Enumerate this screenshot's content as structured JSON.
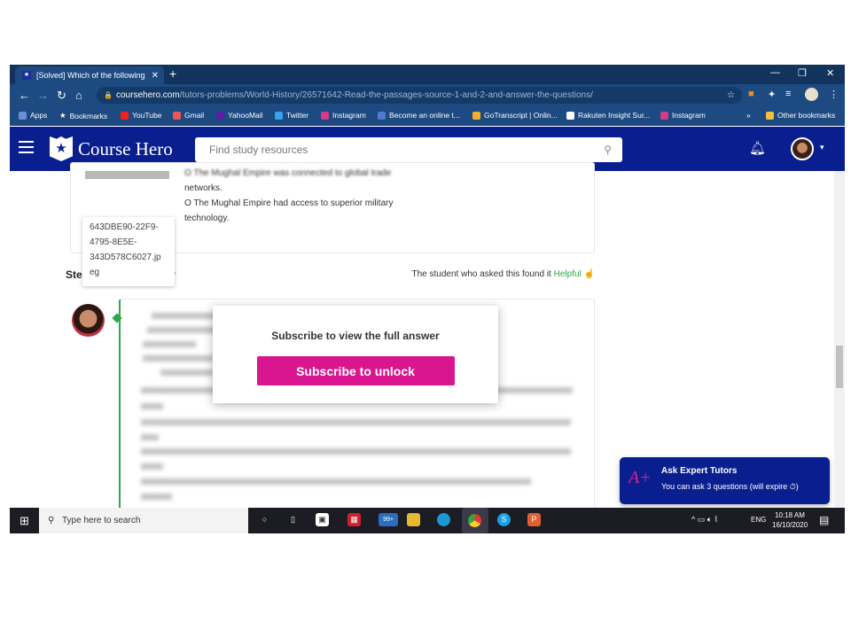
{
  "browser": {
    "tab_title": "[Solved] Which of the following",
    "url_domain": "coursehero.com",
    "url_path": "/tutors-problems/World-History/26571642-Read-the-passages-source-1-and-2-and-answer-the-questions/",
    "bookmarks": [
      "Apps",
      "Bookmarks",
      "YouTube",
      "Gmail",
      "YahooMail",
      "Twitter",
      "Instagram",
      "Become an online t...",
      "GoTranscript | Onlin...",
      "Rakuten Insight Sur...",
      "Instagram"
    ],
    "other_bookmarks": "Other bookmarks"
  },
  "header": {
    "brand": "Course Hero",
    "search_placeholder": "Find study resources"
  },
  "question": {
    "options": [
      "O The Mughal Empire was connected to global trade",
      "networks.",
      "O The Mughal Empire had access to superior military",
      "technology."
    ],
    "file_tooltip": [
      "643DBE90-22F9-",
      "4795-8E5E-",
      "343D578C6027.jp",
      "eg"
    ]
  },
  "answer": {
    "heading_start": "Ste",
    "heading_end": "r",
    "helpful_prefix": "The student who asked this found it",
    "helpful_label": "Helpful"
  },
  "modal": {
    "title": "Subscribe to view the full answer",
    "button": "Subscribe to unlock"
  },
  "expert": {
    "title": "Ask Expert Tutors",
    "subtitle": "You can ask 3 questions (will expire"
  },
  "taskbar": {
    "search_placeholder": "Type here to search",
    "mail_badge": "99+",
    "lang": "ENG",
    "time": "10:18 AM",
    "date": "16/10/2020"
  }
}
